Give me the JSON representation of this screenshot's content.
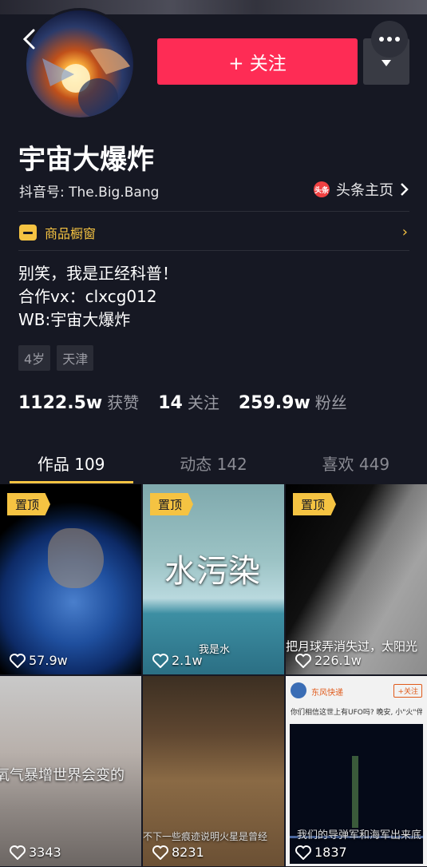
{
  "header": {
    "follow_label": "+ 关注"
  },
  "profile": {
    "name": "宇宙大爆炸",
    "douyin_id": "抖音号: The.Big.Bang",
    "toutiao_icon": "头条",
    "toutiao_label": "头条主页",
    "shop_label": "商品橱窗",
    "bio": [
      "别笑，我是正经科普！",
      "合作vx：clxcg012",
      "WB:宇宙大爆炸"
    ],
    "tags": [
      "4岁",
      "天津"
    ]
  },
  "stats": [
    {
      "num": "1122.5w",
      "label": "获赞"
    },
    {
      "num": "14",
      "label": "关注"
    },
    {
      "num": "259.9w",
      "label": "粉丝"
    }
  ],
  "tabs": [
    {
      "label": "作品 109",
      "active": true
    },
    {
      "label": "动态 142",
      "active": false
    },
    {
      "label": "喜欢 449",
      "active": false
    }
  ],
  "videos": [
    {
      "pinned": "置顶",
      "likes": "57.9w",
      "overlay": ""
    },
    {
      "pinned": "置顶",
      "likes": "2.1w",
      "overlay": "水污染",
      "overlay2": "我是水"
    },
    {
      "pinned": "置顶",
      "likes": "226.1w",
      "overlay": "把月球弄消失过，太阳光"
    },
    {
      "pinned": "",
      "likes": "3343",
      "overlay": "氧气暴增世界会变的"
    },
    {
      "pinned": "",
      "likes": "8231",
      "overlay": "不下一些痕迹说明火星是曾经"
    },
    {
      "pinned": "",
      "likes": "1837",
      "overlay": "你们相信这世上有UFO吗? 晚安, 小\"火\"伴~",
      "account": "东风快递",
      "follow_small": "+关注",
      "overlay2": "我们的导弹军和海军出来底"
    }
  ],
  "colors": {
    "accent_red": "#fe2c55",
    "accent_yellow": "#f5c342",
    "bg": "#161823"
  }
}
